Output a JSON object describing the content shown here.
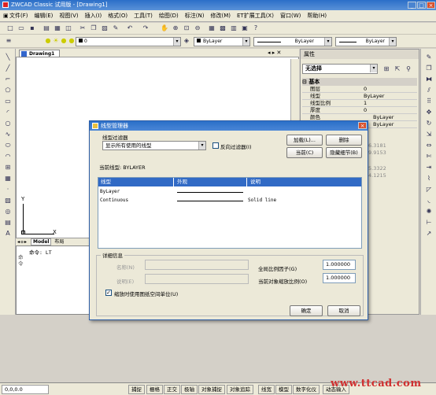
{
  "window": {
    "title": "ZWCAD Classic 试用版 - [Drawing1]"
  },
  "menu": [
    "文件(F)",
    "编辑(E)",
    "视图(V)",
    "插入(I)",
    "格式(O)",
    "工具(T)",
    "绘图(D)",
    "标注(N)",
    "修改(M)",
    "ET扩展工具(X)",
    "窗口(W)",
    "帮助(H)"
  ],
  "toolbar": {
    "layer_value": "0",
    "color_value": "ByLayer",
    "linetype_value": "ByLayer",
    "lineweight_value": "ByLayer"
  },
  "doc_tab": "Drawing1",
  "layout_tabs": [
    "Model",
    "布局"
  ],
  "ucs": {
    "x": "X",
    "y": "Y"
  },
  "command": {
    "side_label": "命令",
    "line": "命令: LT"
  },
  "properties": {
    "title": "属性",
    "selector": "无选择",
    "group": "基本",
    "rows": [
      {
        "k": "图层",
        "v": "0"
      },
      {
        "k": "线型",
        "v": "ByLayer"
      },
      {
        "k": "线型比例",
        "v": "1"
      },
      {
        "k": "厚度",
        "v": "0"
      },
      {
        "k": "颜色",
        "v": "ByLayer"
      },
      {
        "k": "",
        "v": "ByLayer"
      }
    ],
    "hidden_values": [
      "6.3181",
      "9.9153",
      "5.3322",
      "4.1215"
    ]
  },
  "dialog": {
    "title": "线型管理器",
    "filter_label": "线型过滤器",
    "filter_value": "显示所有使用的线型",
    "invert_label": "反向过滤器(I)",
    "load_btn": "加载(L)...",
    "delete_btn": "删除",
    "current_btn": "当前(C)",
    "hide_details_btn": "隐藏细节(B)",
    "current_linetype": "当前线型: BYLAYER",
    "columns": [
      "线型",
      "外观",
      "说明"
    ],
    "linetypes": [
      {
        "name": "ByLayer",
        "desc": ""
      },
      {
        "name": "Continuous",
        "desc": "Solid line"
      }
    ],
    "details_title": "详细信息",
    "name_label": "名称(N)",
    "desc_label": "说明(E)",
    "global_scale_label": "全局比例因子(G)",
    "global_scale": "1.000000",
    "object_scale_label": "当前对象缩放比例(O)",
    "object_scale": "1.000000",
    "paperspace_label": "缩放时使用图纸空间单位(U)",
    "ok": "确定",
    "cancel": "取消"
  },
  "status": {
    "coords": "0,0,0.0",
    "items": [
      "捕捉",
      "栅格",
      "正交",
      "极轴",
      "对象捕捉",
      "对象追踪",
      "线宽",
      "模型",
      "数字化仪",
      "动态输入"
    ]
  },
  "watermark": "www.ttcad.com"
}
